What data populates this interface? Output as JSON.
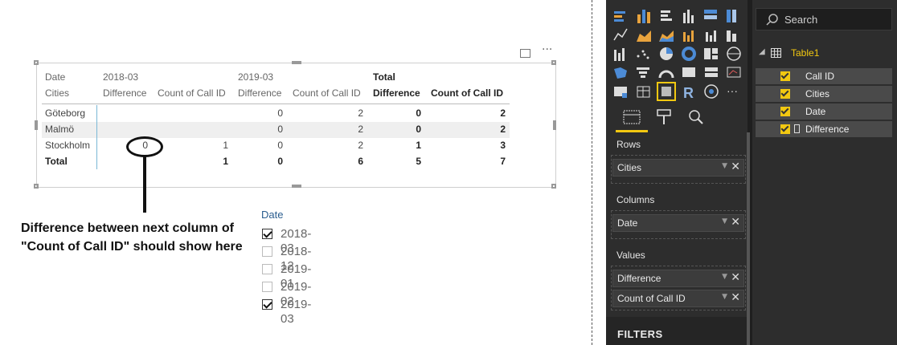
{
  "matrix": {
    "header_row1": {
      "date_label": "Date",
      "col1": "2018-03",
      "col2": "2019-03",
      "col3": "Total"
    },
    "header_row2": {
      "cities": "Cities",
      "c1": "Difference",
      "c2": "Count of Call ID",
      "c3": "Difference",
      "c4": "Count of Call ID",
      "c5": "Difference",
      "c6": "Count of Call ID"
    },
    "rows": [
      {
        "city": "Göteborg",
        "v1": "",
        "v2": "",
        "v3": "0",
        "v4": "2",
        "v5": "0",
        "v6": "2"
      },
      {
        "city": "Malmö",
        "v1": "",
        "v2": "",
        "v3": "0",
        "v4": "2",
        "v5": "0",
        "v6": "2"
      },
      {
        "city": "Stockholm",
        "v1": "0",
        "v2": "1",
        "v3": "0",
        "v4": "2",
        "v5": "1",
        "v6": "3"
      },
      {
        "city": "Total",
        "v1": "",
        "v2": "1",
        "v3": "0",
        "v4": "6",
        "v5": "5",
        "v6": "7"
      }
    ],
    "more_label": "···"
  },
  "annotation": {
    "line1": "Difference between next column of",
    "line2": "\"Count of Call ID\" should show here"
  },
  "slicer": {
    "title": "Date",
    "items": [
      {
        "label": "2018-03",
        "checked": true
      },
      {
        "label": "2018-12",
        "checked": false
      },
      {
        "label": "2019-01",
        "checked": false
      },
      {
        "label": "2019-02",
        "checked": false
      },
      {
        "label": "2019-03",
        "checked": true
      }
    ]
  },
  "viz_pane": {
    "sections": {
      "rows": "Rows",
      "columns": "Columns",
      "values": "Values"
    },
    "wells": {
      "rows": [
        "Cities"
      ],
      "columns": [
        "Date"
      ],
      "values": [
        "Difference",
        "Count of Call ID"
      ]
    },
    "filters_label": "FILTERS",
    "r_visual_label": "R",
    "more_label": "···",
    "accent": "#f2c811"
  },
  "fields_pane": {
    "search_placeholder": "Search",
    "table_name": "Table1",
    "fields": [
      "Call ID",
      "Cities",
      "Date",
      "Difference"
    ]
  }
}
